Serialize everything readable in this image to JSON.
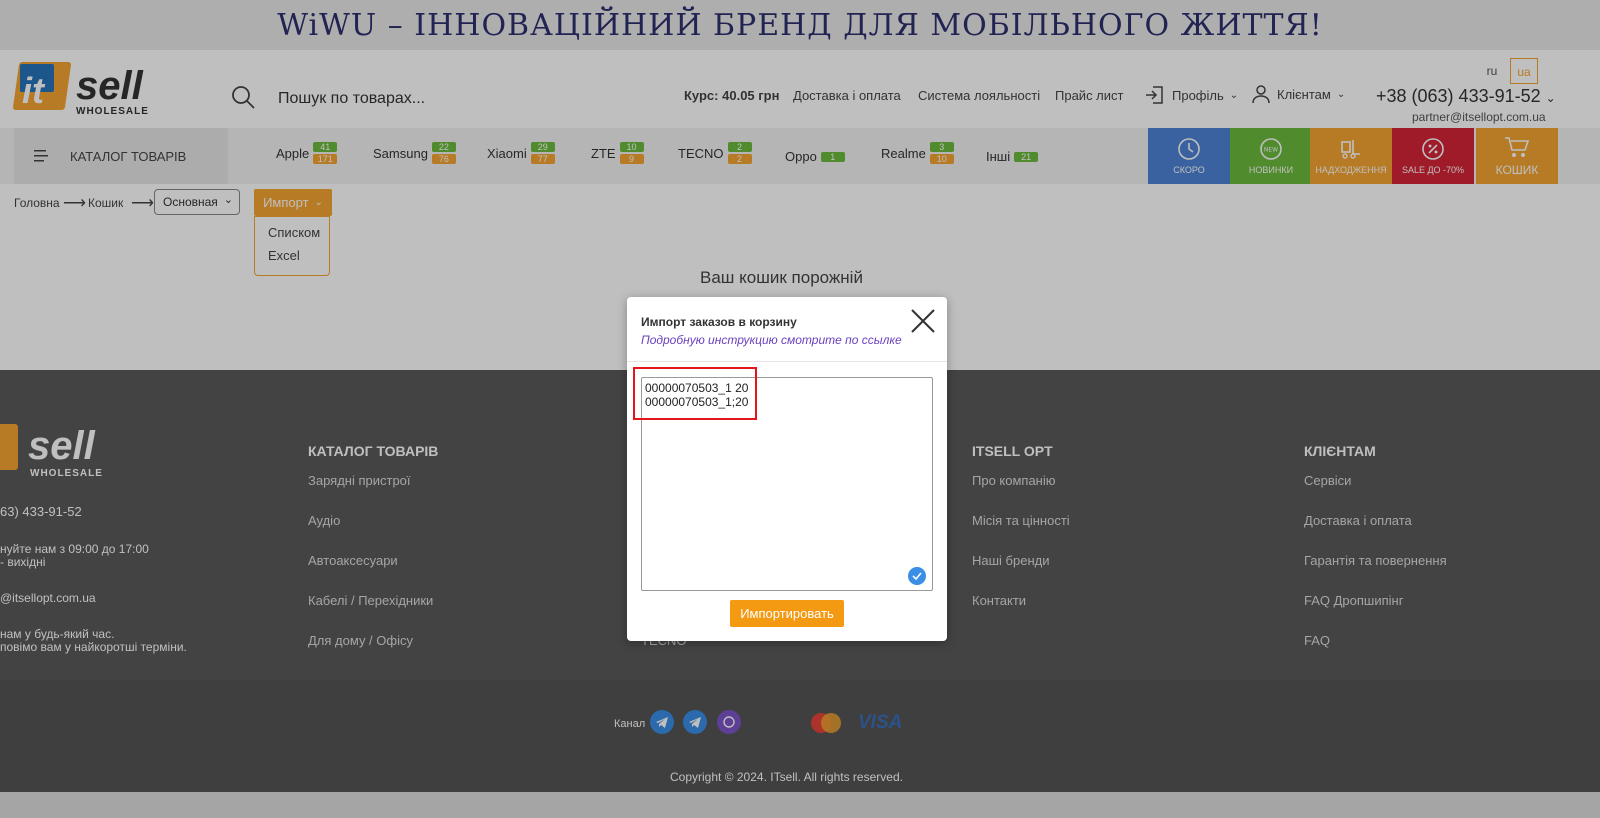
{
  "banner": {
    "text": "WiWU – ІННОВАЦІЙНИЙ БРЕНД ДЛЯ МОБІЛЬНОГО ЖИТТЯ!"
  },
  "logo": {
    "it": "it",
    "sell": "sell",
    "wholesale": "WHOLESALE"
  },
  "search": {
    "placeholder": "Пошук по товарах..."
  },
  "header": {
    "rate_label": "Курс:",
    "rate_value": "40.05 грн",
    "links": [
      "Доставка і оплата",
      "Система лояльності",
      "Прайс лист"
    ],
    "profile": "Профіль",
    "clients": "Клієнтам",
    "lang_ru": "ru",
    "lang_ua": "ua",
    "phone": "+38 (063) 433-91-52",
    "email": "partner@itsellopt.com.ua"
  },
  "catalog": {
    "label": "КАТАЛОГ ТОВАРІВ"
  },
  "brands": [
    {
      "name": "Apple",
      "new": "41",
      "total": "171"
    },
    {
      "name": "Samsung",
      "new": "22",
      "total": "76"
    },
    {
      "name": "Xiaomi",
      "new": "29",
      "total": "77"
    },
    {
      "name": "ZTE",
      "new": "10",
      "total": "9"
    },
    {
      "name": "TECNO",
      "new": "2",
      "total": "2"
    },
    {
      "name": "Oppo",
      "new": "1",
      "total": ""
    },
    {
      "name": "Realme",
      "new": "3",
      "total": "10"
    },
    {
      "name": "Інші",
      "new": "21",
      "total": ""
    }
  ],
  "tiles": [
    {
      "label": "СКОРО",
      "color": "#4e83d6"
    },
    {
      "label": "НОВИНКИ",
      "color": "#6bbb3c"
    },
    {
      "label": "НАДХОДЖЕННЯ",
      "color": "#f3a530"
    },
    {
      "label": "SALE ДО -70%",
      "color": "#d42437"
    },
    {
      "label": "КОШИК",
      "color": "#f3a530"
    }
  ],
  "breadcrumb": {
    "home": "Головна",
    "cart": "Кошик",
    "select_value": "Основная"
  },
  "import": {
    "button": "Импорт",
    "menu": [
      "Списком",
      "Excel"
    ]
  },
  "cart": {
    "empty": "Ваш кошик порожній"
  },
  "footer": {
    "phone_partial": "63) 433-91-52",
    "hours_1": "нуйте нам з 09:00 до 17:00",
    "hours_2": "- вихідні",
    "email_partial": "@itsellopt.com.ua",
    "note_1": "нам у будь-який час.",
    "note_2": "повімо вам у найкоротші терміни.",
    "catalog_title": "КАТАЛОГ ТОВАРІВ",
    "catalog_links": [
      "Зарядні пристрої",
      "Аудіо",
      "Автоаксесуари",
      "Кабелі / Перехідники",
      "Для дому / Офісу"
    ],
    "col2_partial": "TECNO",
    "itsell_title": "ITSELL OPT",
    "itsell_links": [
      "Про компанію",
      "Місія та цінності",
      "Наші бренди",
      "Контакти"
    ],
    "clients_title": "КЛІЄНТАМ",
    "clients_links": [
      "Сервіси",
      "Доставка і оплата",
      "Гарантія та повернення",
      "FAQ Дропшипінг",
      "FAQ"
    ],
    "channel": "Канал",
    "visa": "VISA",
    "mastercard": "MasterCard",
    "copyright": "Copyright © 2024. ITsell. All rights reserved."
  },
  "modal": {
    "title": "Импорт заказов в корзину",
    "link": "Подробную инструкцию смотрите по ссылке",
    "textarea": "00000070503_1 20\n00000070503_1;20",
    "import_button": "Импортировать"
  }
}
